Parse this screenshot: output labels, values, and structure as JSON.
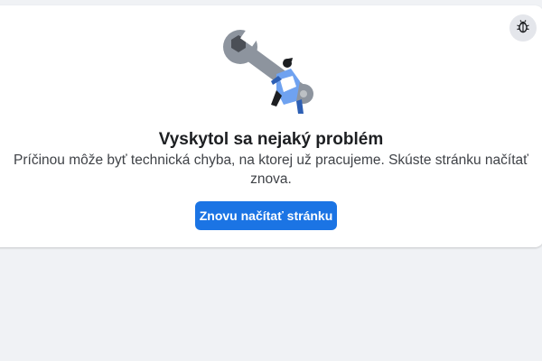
{
  "error": {
    "title": "Vyskytol sa nejaký problém",
    "message": "Príčinou môže byť technická chyba, na ktorej už pracujeme. Skúste stránku načítať znova.",
    "reload_label": "Znovu načítať stránku",
    "illustration": "wrench-with-person",
    "report_icon": "bug-icon"
  },
  "colors": {
    "accent": "#1b74e4",
    "card_background": "#ffffff",
    "page_background": "#f0f2f5",
    "title_text": "#1c1e21",
    "body_text": "#3f4247"
  }
}
